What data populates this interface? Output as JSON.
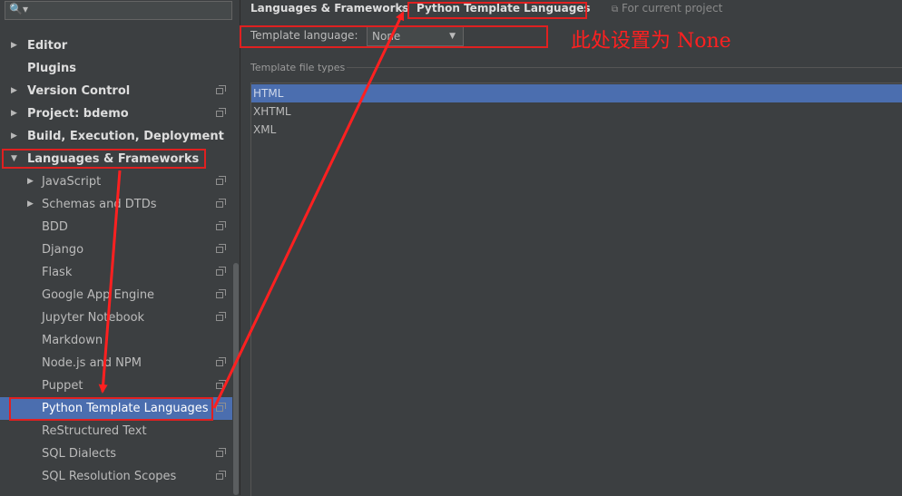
{
  "search": {
    "placeholder": "",
    "value": ""
  },
  "sidebar": {
    "items": [
      {
        "label": "Editor",
        "arrow": "▶",
        "bold": true,
        "project": false
      },
      {
        "label": "Plugins",
        "arrow": "",
        "bold": true,
        "project": false
      },
      {
        "label": "Version Control",
        "arrow": "▶",
        "bold": true,
        "project": true
      },
      {
        "label": "Project: bdemo",
        "arrow": "▶",
        "bold": true,
        "project": true
      },
      {
        "label": "Build, Execution, Deployment",
        "arrow": "▶",
        "bold": true,
        "project": false
      },
      {
        "label": "Languages & Frameworks",
        "arrow": "▼",
        "bold": true,
        "project": false
      },
      {
        "label": "JavaScript",
        "arrow": "▶",
        "bold": false,
        "project": true
      },
      {
        "label": "Schemas and DTDs",
        "arrow": "▶",
        "bold": false,
        "project": true
      },
      {
        "label": "BDD",
        "arrow": "",
        "bold": false,
        "project": true
      },
      {
        "label": "Django",
        "arrow": "",
        "bold": false,
        "project": true
      },
      {
        "label": "Flask",
        "arrow": "",
        "bold": false,
        "project": true
      },
      {
        "label": "Google App Engine",
        "arrow": "",
        "bold": false,
        "project": true
      },
      {
        "label": "Jupyter Notebook",
        "arrow": "",
        "bold": false,
        "project": true
      },
      {
        "label": "Markdown",
        "arrow": "",
        "bold": false,
        "project": false
      },
      {
        "label": "Node.js and NPM",
        "arrow": "",
        "bold": false,
        "project": true
      },
      {
        "label": "Puppet",
        "arrow": "",
        "bold": false,
        "project": true
      },
      {
        "label": "Python Template Languages",
        "arrow": "",
        "bold": false,
        "project": true,
        "selected": true
      },
      {
        "label": "ReStructured Text",
        "arrow": "",
        "bold": false,
        "project": false
      },
      {
        "label": "SQL Dialects",
        "arrow": "",
        "bold": false,
        "project": true
      },
      {
        "label": "SQL Resolution Scopes",
        "arrow": "",
        "bold": false,
        "project": true
      }
    ]
  },
  "breadcrumb": {
    "parent": "Languages & Frameworks",
    "separator": "›",
    "current": "Python Template Languages",
    "scope": "For current project"
  },
  "template_language": {
    "label": "Template language:",
    "value": "None"
  },
  "file_types": {
    "title": "Template file types",
    "items": [
      "HTML",
      "XHTML",
      "XML"
    ],
    "selected_index": 0
  },
  "annotation": {
    "text": "此处设置为 None",
    "color": "#ff2020"
  },
  "colors": {
    "selection": "#4b6eaf",
    "background": "#3c3f41",
    "highlight_box": "#e02020"
  }
}
